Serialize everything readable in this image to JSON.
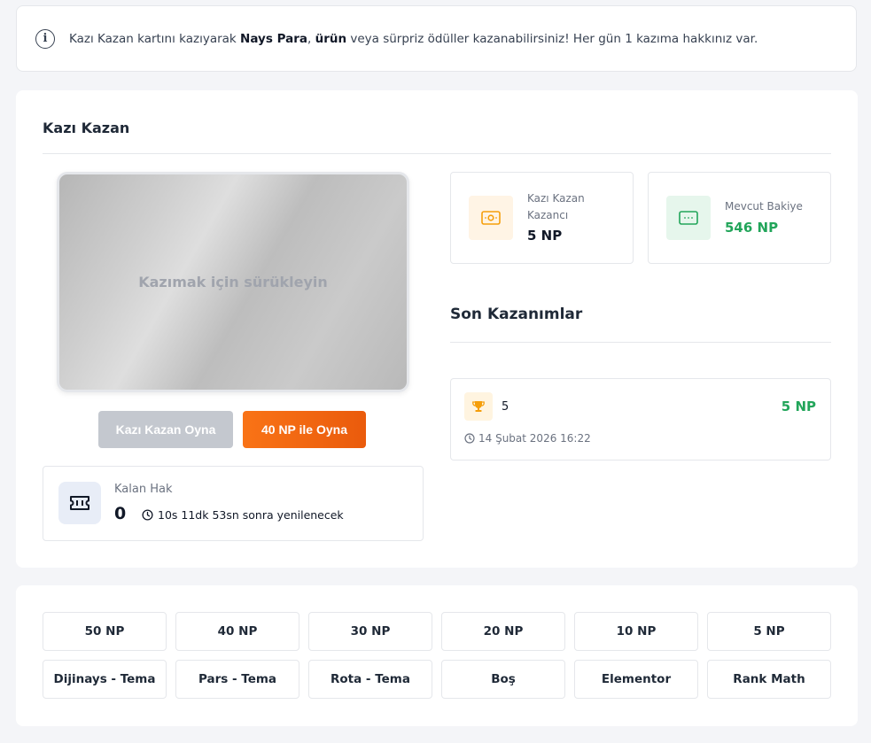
{
  "info": {
    "prefix": "Kazı Kazan kartını kazıyarak ",
    "bold1": "Nays Para",
    "mid": ", ",
    "bold2": "ürün",
    "suffix": " veya sürpriz ödüller kazanabilirsiniz! Her gün 1 kazıma hakkınız var."
  },
  "main": {
    "title": "Kazı Kazan",
    "scratch_hint": "Kazımak için sürükleyin",
    "play_button": "Kazı Kazan Oyna",
    "paid_play_button": "40 NP ile Oyna",
    "rights": {
      "label": "Kalan Hak",
      "count": "0",
      "timer": "10s 11dk 53sn sonra yenilenecek"
    }
  },
  "stats": {
    "earnings_label": "Kazı Kazan Kazancı",
    "earnings_value": "5 NP",
    "balance_label": "Mevcut Bakiye",
    "balance_value": "546 NP"
  },
  "recent": {
    "title": "Son Kazanımlar",
    "items": [
      {
        "name": "5",
        "amount": "5 NP",
        "date": "14 Şubat 2026 16:22"
      }
    ]
  },
  "prizes": [
    "50 NP",
    "40 NP",
    "30 NP",
    "20 NP",
    "10 NP",
    "5 NP",
    "Dijinays - Tema",
    "Pars - Tema",
    "Rota - Tema",
    "Boş",
    "Elementor",
    "Rank Math"
  ],
  "colors": {
    "accent_orange": "#f97316",
    "success_green": "#22a55a"
  }
}
